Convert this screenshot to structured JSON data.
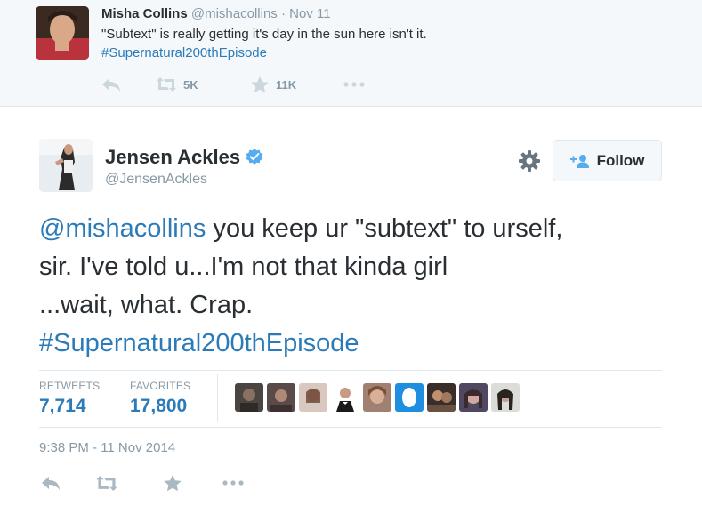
{
  "parent_tweet": {
    "name": "Misha Collins",
    "handle": "@mishacollins",
    "separator": "·",
    "date": "Nov 11",
    "text": "\"Subtext\" is really getting it's day in the sun here isn't it.",
    "hashtag": "#Supernatural200thEpisode",
    "actions": {
      "reply_icon": "reply-icon",
      "retweet_icon": "retweet-icon",
      "retweet_count": "5K",
      "favorite_icon": "star-icon",
      "favorite_count": "11K",
      "more_icon": "more-icon"
    }
  },
  "main_tweet": {
    "name": "Jensen Ackles",
    "verified_icon": "verified-badge-icon",
    "handle": "@JensenAckles",
    "follow_label": "Follow",
    "text_lines": [
      {
        "mention": "@mishacollins",
        "rest": " you keep ur \"subtext\" to urself,"
      },
      {
        "text": "sir.  I've told u...I'm not that kinda girl"
      },
      {
        "text": "...wait, what.  Crap."
      },
      {
        "hashtag": "#Supernatural200thEpisode"
      }
    ],
    "stats": {
      "retweets_label": "RETWEETS",
      "retweets_value": "7,714",
      "favorites_label": "FAVORITES",
      "favorites_value": "17,800"
    },
    "timestamp": "9:38 PM - 11 Nov 2014"
  },
  "colors": {
    "link": "#2b7bb9",
    "muted": "#8899a6",
    "verified": "#55acee",
    "parent_bg": "#f5f8fa"
  }
}
